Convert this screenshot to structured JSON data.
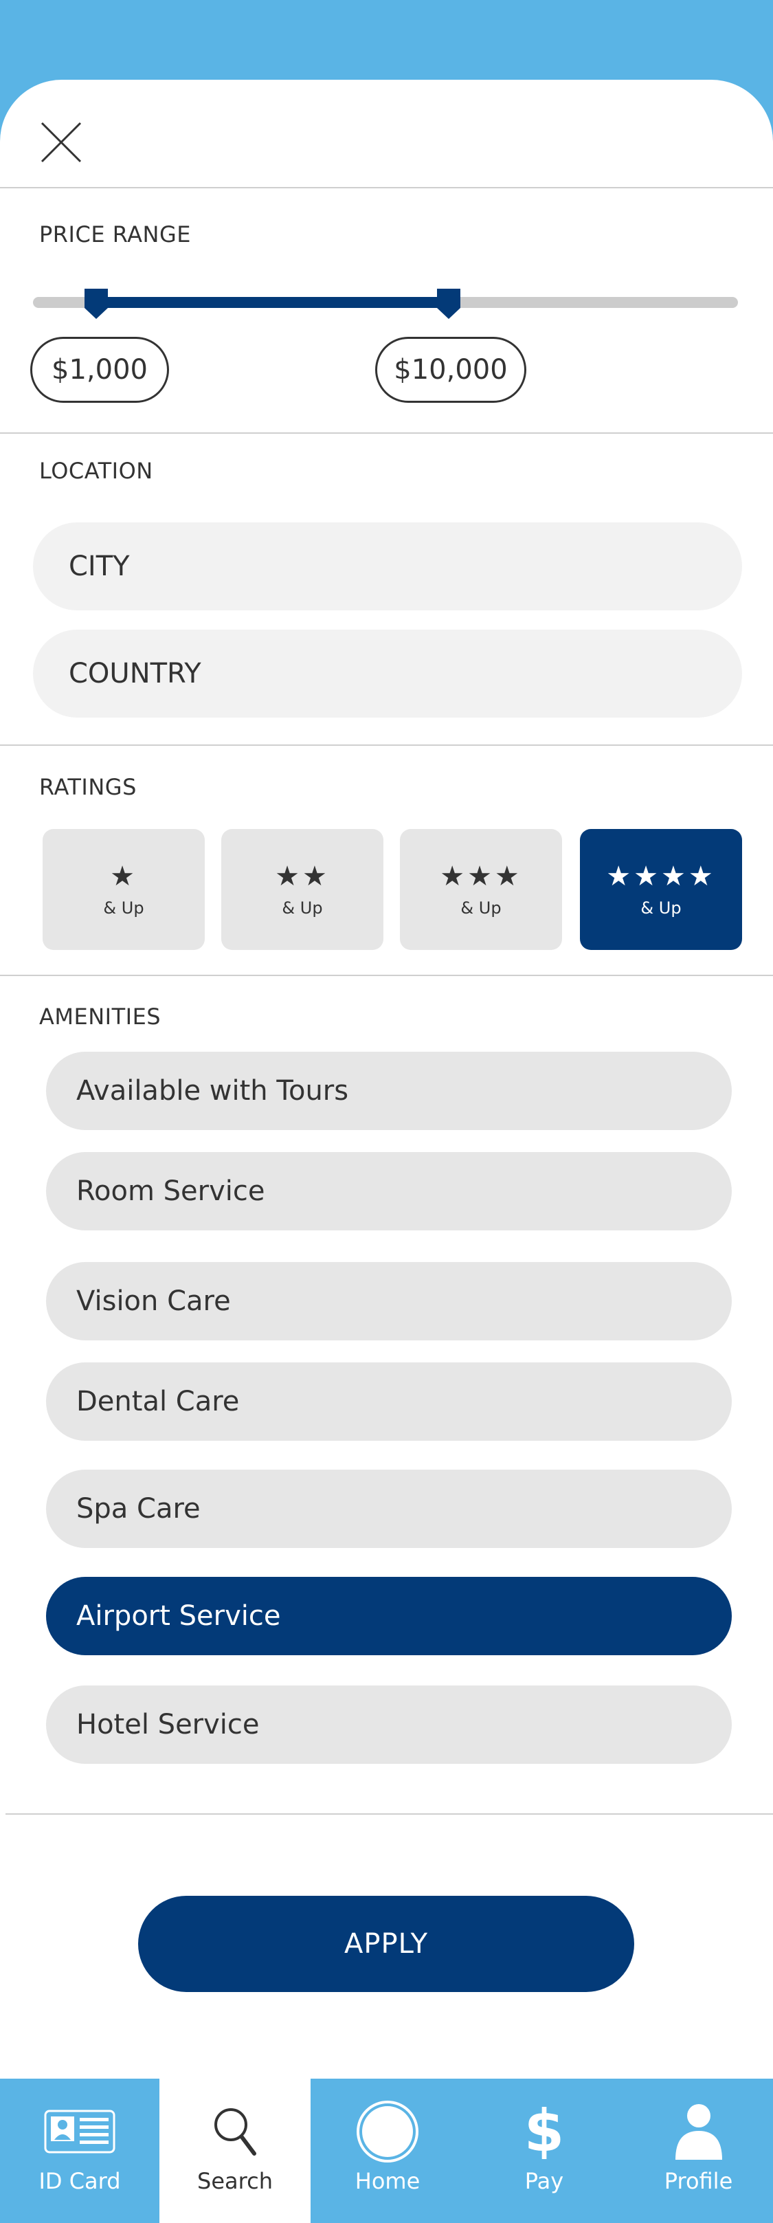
{
  "price_range": {
    "title": "PRICE RANGE",
    "min_label": "$1,000",
    "max_label": "$10,000",
    "min_fraction": 0.09,
    "max_fraction": 0.59
  },
  "location": {
    "title": "LOCATION",
    "city_placeholder": "CITY",
    "country_placeholder": "COUNTRY"
  },
  "ratings": {
    "title": "RATINGS",
    "options": [
      {
        "stars": "★",
        "label": "& Up",
        "selected": false
      },
      {
        "stars": "★★",
        "label": "& Up",
        "selected": false
      },
      {
        "stars": "★★★",
        "label": "& Up",
        "selected": false
      },
      {
        "stars": "★★★★",
        "label": "& Up",
        "selected": true
      }
    ]
  },
  "amenities": {
    "title": "AMENITIES",
    "items": [
      {
        "label": "Available with Tours",
        "selected": false
      },
      {
        "label": "Room Service",
        "selected": false
      },
      {
        "label": "Vision Care",
        "selected": false
      },
      {
        "label": "Dental Care",
        "selected": false
      },
      {
        "label": "Spa Care",
        "selected": false
      },
      {
        "label": "Airport Service",
        "selected": true
      },
      {
        "label": "Hotel Service",
        "selected": false
      }
    ]
  },
  "apply_label": "APPLY",
  "tabbar": {
    "tabs": [
      {
        "label": "ID Card",
        "icon": "id-card-icon",
        "active": false
      },
      {
        "label": "Search",
        "icon": "search-icon",
        "active": true
      },
      {
        "label": "Home",
        "icon": "home-circle-icon",
        "active": false
      },
      {
        "label": "Pay",
        "icon": "dollar-icon",
        "active": false
      },
      {
        "label": "Profile",
        "icon": "profile-icon",
        "active": false
      }
    ]
  },
  "colors": {
    "brand_light": "#5ab4e5",
    "brand_dark": "#033a78",
    "chip": "#e6e6e6",
    "field": "#f2f2f2"
  }
}
